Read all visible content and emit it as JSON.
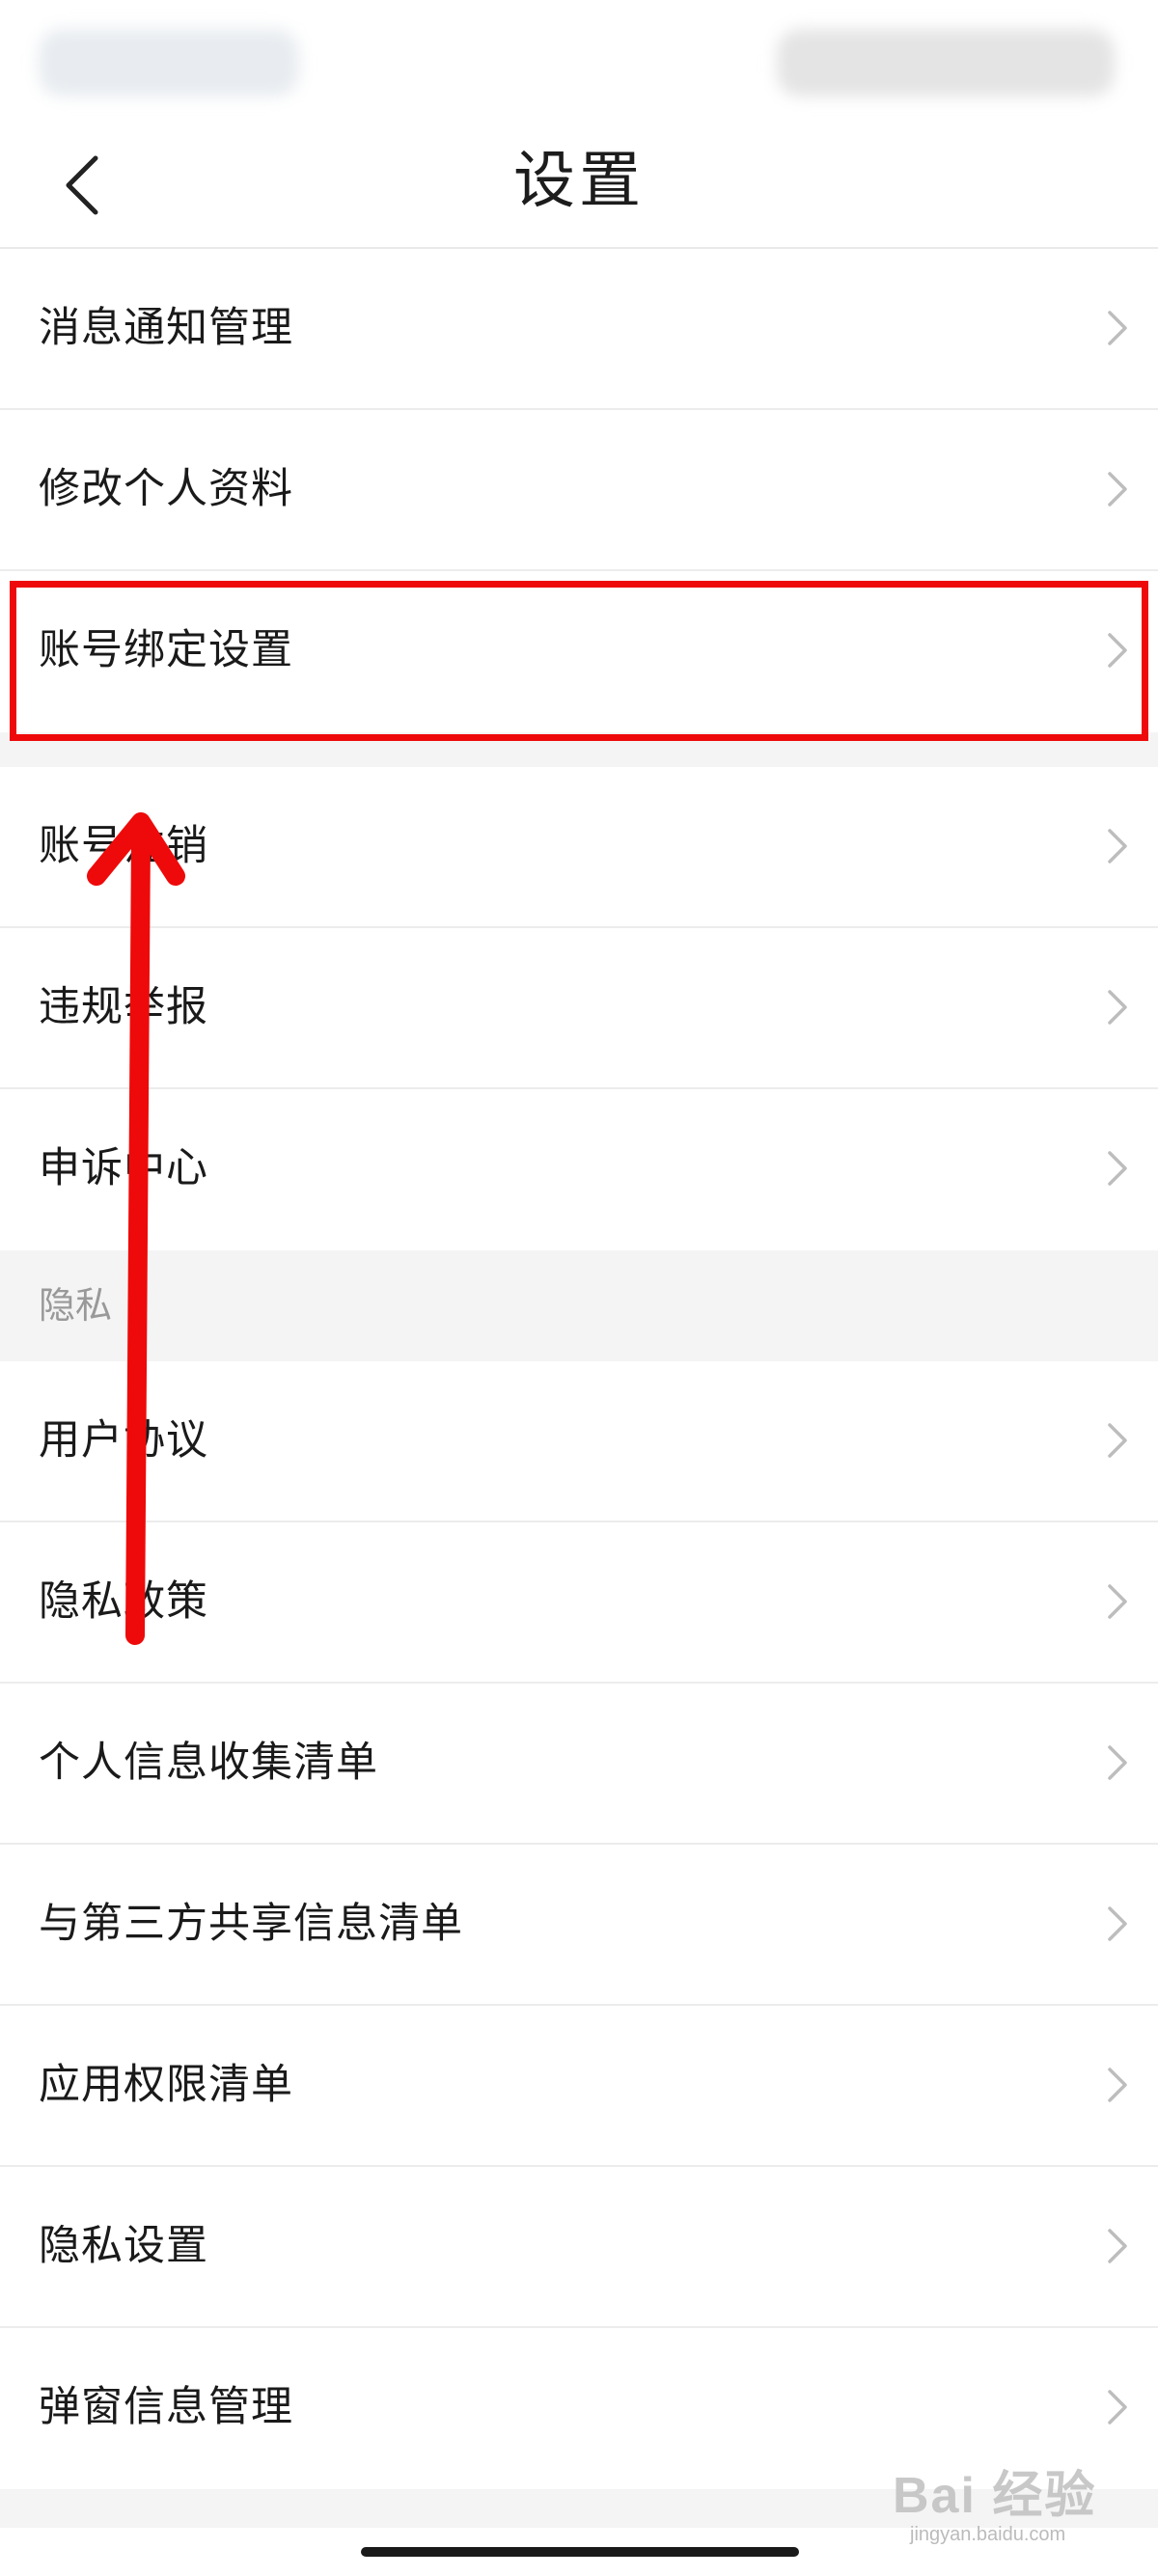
{
  "header": {
    "title": "设置",
    "back_icon": "chevron-left-icon"
  },
  "account_section": {
    "items": [
      {
        "label": "消息通知管理"
      },
      {
        "label": "修改个人资料"
      },
      {
        "label": "账号绑定设置"
      }
    ]
  },
  "misc_section": {
    "items": [
      {
        "label": "账号注销"
      },
      {
        "label": "违规举报"
      },
      {
        "label": "申诉中心"
      }
    ]
  },
  "privacy_section": {
    "header": "隐私",
    "items": [
      {
        "label": "用户协议"
      },
      {
        "label": "隐私政策"
      },
      {
        "label": "个人信息收集清单"
      },
      {
        "label": "与第三方共享信息清单"
      },
      {
        "label": "应用权限清单"
      },
      {
        "label": "隐私设置"
      },
      {
        "label": "弹窗信息管理"
      }
    ]
  },
  "annotation": {
    "highlight_color": "#ee0a0a",
    "arrow_color": "#ee0a0a"
  },
  "watermark": {
    "main": "Bai 经验",
    "sub": "jingyan.baidu.com"
  },
  "colors": {
    "separator": "#ececec",
    "section_bg": "#f4f4f4",
    "text": "#1a1a1a",
    "muted": "#999999",
    "chevron": "#bdbdbd"
  }
}
